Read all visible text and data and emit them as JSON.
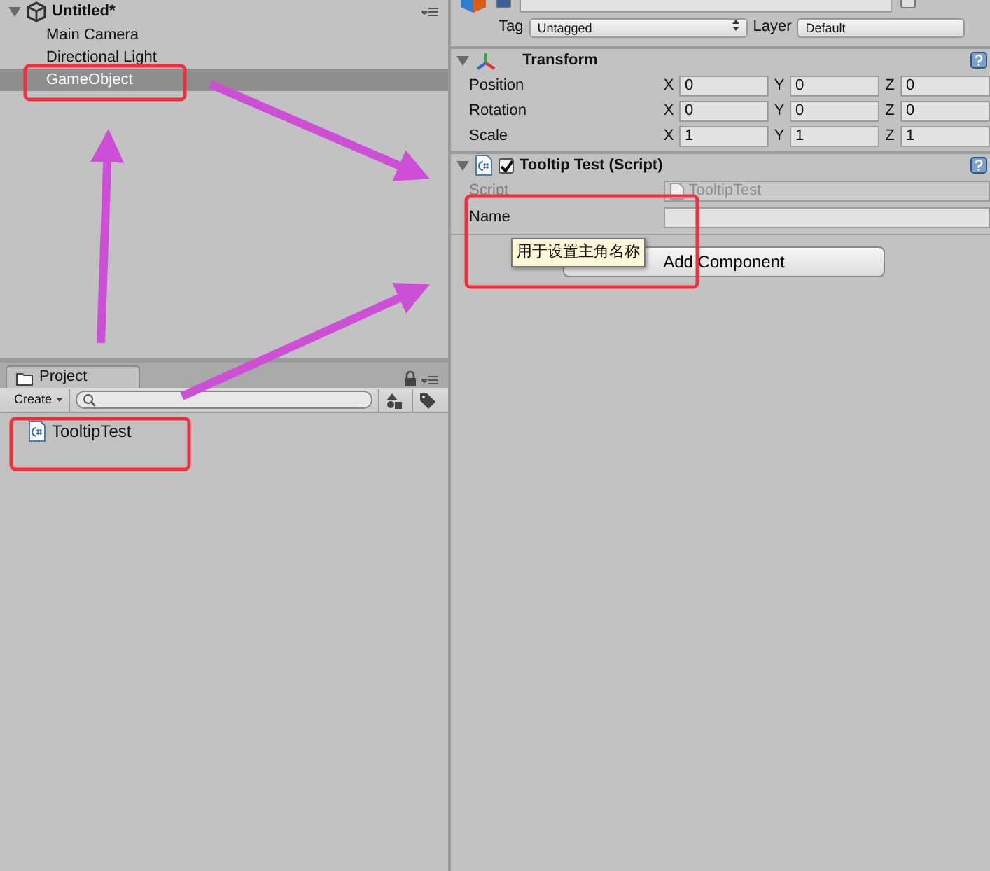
{
  "hierarchy": {
    "title": "Untitled*",
    "items": [
      {
        "label": "Main Camera",
        "selected": false
      },
      {
        "label": "Directional Light",
        "selected": false
      },
      {
        "label": "GameObject",
        "selected": true
      }
    ]
  },
  "project": {
    "tab": "Project",
    "create_button": "Create",
    "assets": [
      {
        "label": "TooltipTest"
      }
    ]
  },
  "inspector": {
    "active": true,
    "is_static": false,
    "tag_label": "Tag",
    "tag_value": "Untagged",
    "layer_label": "Layer",
    "layer_value": "Default",
    "components": [
      {
        "kind": "transform",
        "title": "Transform",
        "expanded": true,
        "rows": [
          {
            "label": "Position",
            "fields": [
              {
                "axis": "X",
                "value": "0"
              },
              {
                "axis": "Y",
                "value": "0"
              },
              {
                "axis": "Z",
                "value": "0"
              }
            ]
          },
          {
            "label": "Rotation",
            "fields": [
              {
                "axis": "X",
                "value": "0"
              },
              {
                "axis": "Y",
                "value": "0"
              },
              {
                "axis": "Z",
                "value": "0"
              }
            ]
          },
          {
            "label": "Scale",
            "fields": [
              {
                "axis": "X",
                "value": "1"
              },
              {
                "axis": "Y",
                "value": "1"
              },
              {
                "axis": "Z",
                "value": "1"
              }
            ]
          }
        ]
      },
      {
        "kind": "script",
        "title": "Tooltip Test (Script)",
        "expanded": true,
        "enabled": true,
        "properties": [
          {
            "label": "Script",
            "value": "TooltipTest",
            "disabled": true
          },
          {
            "label": "Name",
            "disabled": false
          }
        ]
      }
    ],
    "add_component": "Add Component",
    "tooltip": "用于设置主角名称"
  }
}
